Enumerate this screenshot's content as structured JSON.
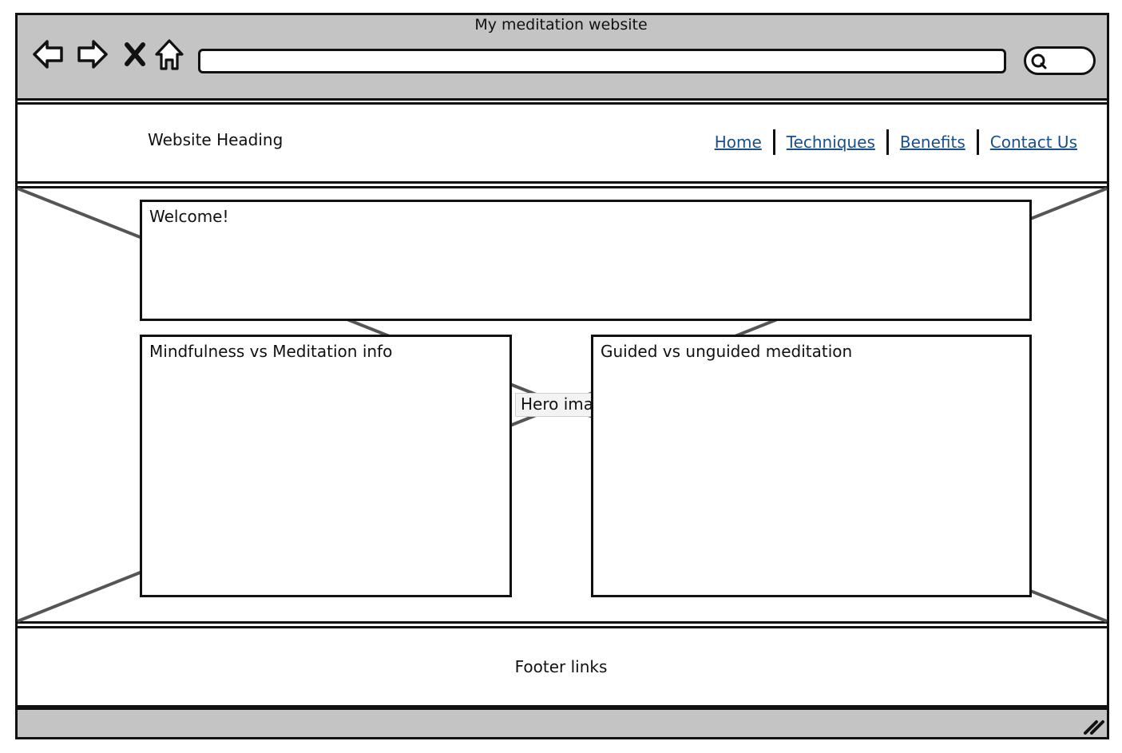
{
  "browser": {
    "window_title": "My meditation website",
    "url": "",
    "search_value": "",
    "icons": [
      "back-arrow-icon",
      "forward-arrow-icon",
      "close-icon",
      "home-icon",
      "search-icon",
      "resize-grip-icon"
    ]
  },
  "site": {
    "heading": "Website Heading",
    "nav": [
      "Home",
      "Techniques",
      "Benefits",
      "Contact Us"
    ],
    "link_color": "#1a4f8c"
  },
  "hero": {
    "label": "Hero image",
    "welcome": "Welcome!",
    "panel_left": "Mindfulness vs Meditation info",
    "panel_right": "Guided vs unguided meditation"
  },
  "footer": {
    "text": "Footer links"
  },
  "colors": {
    "chrome": "#c4c4c4",
    "border": "#111111",
    "placeholder_line": "#555555"
  }
}
